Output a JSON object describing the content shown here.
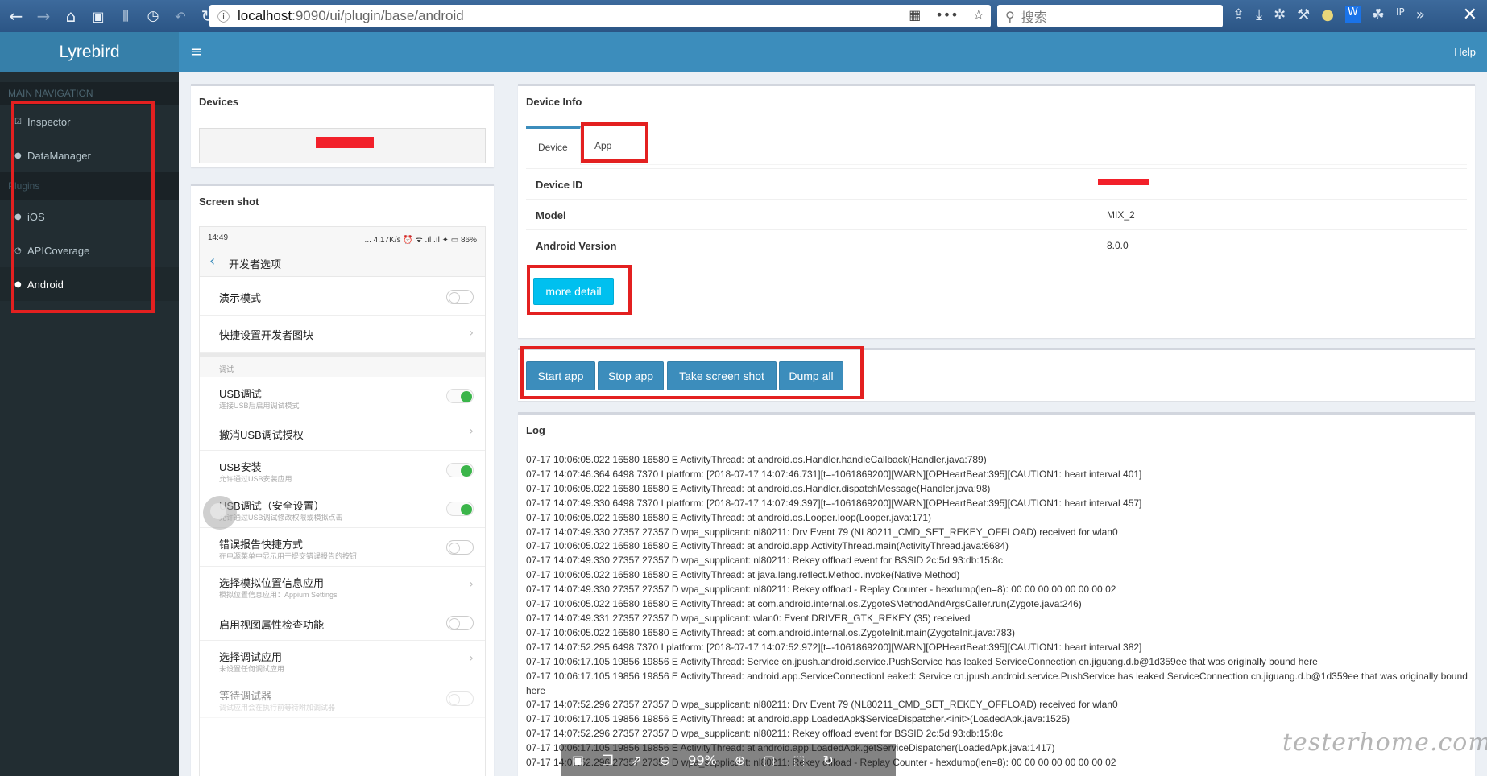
{
  "browser": {
    "url_host": "localhost",
    "url_path": ":9090/ui/plugin/base/android",
    "search_placeholder": "搜索",
    "icons": [
      "back-icon",
      "forward-icon",
      "home-icon",
      "sidebar-icon",
      "library-icon",
      "history-icon",
      "undo-icon",
      "reload-icon"
    ]
  },
  "app": {
    "logo": "Lyrebird",
    "menu_icon": "≡",
    "help": "Help"
  },
  "sidebar": {
    "main_header": "MAIN NAVIGATION",
    "plugins_header": "Plugins",
    "items": [
      {
        "label": "Inspector",
        "icon": "check-square-icon"
      },
      {
        "label": "DataManager",
        "icon": "database-icon"
      },
      {
        "label": "iOS",
        "icon": "apple-icon"
      },
      {
        "label": "APICoverage",
        "icon": "pie-chart-icon"
      },
      {
        "label": "Android",
        "icon": "android-icon"
      }
    ]
  },
  "devices": {
    "title": "Devices"
  },
  "screenshot": {
    "title": "Screen shot",
    "phone": {
      "time": "14:49",
      "status": "... 4.17K/s ⏰ ᯤ .ıl .ıl ✦ ▭ 86%",
      "page_title": "开发者选项",
      "section_debug": "调试",
      "rows": [
        {
          "title": "演示模式",
          "sub": ""
        },
        {
          "title": "快捷设置开发者图块",
          "sub": ""
        },
        {
          "title": "USB调试",
          "sub": "连接USB后启用调试模式"
        },
        {
          "title": "撤消USB调试授权",
          "sub": ""
        },
        {
          "title": "USB安装",
          "sub": "允许通过USB安装应用"
        },
        {
          "title": "USB调试（安全设置）",
          "sub": "允许通过USB调试修改权限或模拟点击"
        },
        {
          "title": "错误报告快捷方式",
          "sub": "在电源菜单中显示用于提交错误报告的按钮"
        },
        {
          "title": "选择模拟位置信息应用",
          "sub": "模拟位置信息应用：Appium Settings"
        },
        {
          "title": "启用视图属性检查功能",
          "sub": ""
        },
        {
          "title": "选择调试应用",
          "sub": "未设置任何调试应用"
        },
        {
          "title": "等待调试器",
          "sub": "调试应用会在执行前等待附加调试器"
        }
      ]
    }
  },
  "device_info": {
    "title": "Device Info",
    "tabs": [
      "Device",
      "App"
    ],
    "rows": [
      {
        "key": "Device ID",
        "value": ""
      },
      {
        "key": "Model",
        "value": "MIX_2"
      },
      {
        "key": "Android Version",
        "value": "8.0.0"
      }
    ],
    "more_detail": "more detail"
  },
  "actions": [
    "Start app",
    "Stop app",
    "Take screen shot",
    "Dump all"
  ],
  "log": {
    "title": "Log",
    "lines": [
      "07-17 10:06:05.022 16580 16580 E ActivityThread: at android.os.Handler.handleCallback(Handler.java:789)",
      "07-17 14:07:46.364 6498 7370 I platform: [2018-07-17 14:07:46.731][t=-1061869200][WARN][OPHeartBeat:395][CAUTION1: heart interval 401]",
      "07-17 10:06:05.022 16580 16580 E ActivityThread: at android.os.Handler.dispatchMessage(Handler.java:98)",
      "07-17 14:07:49.330 6498 7370 I platform: [2018-07-17 14:07:49.397][t=-1061869200][WARN][OPHeartBeat:395][CAUTION1: heart interval 457]",
      "07-17 10:06:05.022 16580 16580 E ActivityThread: at android.os.Looper.loop(Looper.java:171)",
      "07-17 14:07:49.330 27357 27357 D wpa_supplicant: nl80211: Drv Event 79 (NL80211_CMD_SET_REKEY_OFFLOAD) received for wlan0",
      "07-17 10:06:05.022 16580 16580 E ActivityThread: at android.app.ActivityThread.main(ActivityThread.java:6684)",
      "07-17 14:07:49.330 27357 27357 D wpa_supplicant: nl80211: Rekey offload event for BSSID 2c:5d:93:db:15:8c",
      "07-17 10:06:05.022 16580 16580 E ActivityThread: at java.lang.reflect.Method.invoke(Native Method)",
      "07-17 14:07:49.330 27357 27357 D wpa_supplicant: nl80211: Rekey offload - Replay Counter - hexdump(len=8): 00 00 00 00 00 00 00 02",
      "07-17 10:06:05.022 16580 16580 E ActivityThread: at com.android.internal.os.Zygote$MethodAndArgsCaller.run(Zygote.java:246)",
      "07-17 14:07:49.331 27357 27357 D wpa_supplicant: wlan0: Event DRIVER_GTK_REKEY (35) received",
      "07-17 10:06:05.022 16580 16580 E ActivityThread: at com.android.internal.os.ZygoteInit.main(ZygoteInit.java:783)",
      "07-17 14:07:52.295 6498 7370 I platform: [2018-07-17 14:07:52.972][t=-1061869200][WARN][OPHeartBeat:395][CAUTION1: heart interval 382]",
      "07-17 10:06:17.105 19856 19856 E ActivityThread: Service cn.jpush.android.service.PushService has leaked ServiceConnection cn.jiguang.d.b@1d359ee that was originally bound here",
      "07-17 10:06:17.105 19856 19856 E ActivityThread: android.app.ServiceConnectionLeaked: Service cn.jpush.android.service.PushService has leaked ServiceConnection cn.jiguang.d.b@1d359ee that was originally bound here",
      "07-17 14:07:52.296 27357 27357 D wpa_supplicant: nl80211: Drv Event 79 (NL80211_CMD_SET_REKEY_OFFLOAD) received for wlan0",
      "07-17 10:06:17.105 19856 19856 E ActivityThread: at android.app.LoadedApk$ServiceDispatcher.<init>(LoadedApk.java:1525)",
      "07-17 14:07:52.296 27357 27357 D wpa_supplicant: nl80211: Rekey offload event for BSSID 2c:5d:93:db:15:8c",
      "07-17 10:06:17.105 19856 19856 E ActivityThread: at android.app.LoadedApk.getServiceDispatcher(LoadedApk.java:1417)",
      "07-17 14:07:52.296 27357 27357 D wpa_supplicant: nl80211: Rekey offload - Replay Counter - hexdump(len=8): 00 00 00 00 00 00 00 02"
    ]
  },
  "viewer": {
    "zoom": "99%"
  },
  "watermark": "testerhome.com"
}
